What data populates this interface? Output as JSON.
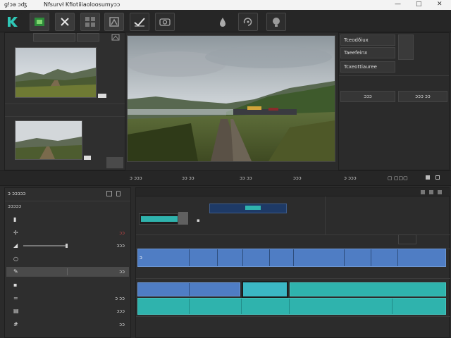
{
  "titlebar": {
    "app_text": "ɡǃɔə ɔʤ",
    "doc_text": "Nfsurvł Kfiotiiiaoloosumyɔɔ",
    "minimize": "—",
    "maximize": "□",
    "close": "✕"
  },
  "toolbar": {
    "icons": [
      "k-logo-icon",
      "film-icon",
      "close-x-icon",
      "grid-icon",
      "layers-icon",
      "checkmark-icon",
      "camera-icon",
      "drop-icon",
      "rotate-icon",
      "globe-icon"
    ]
  },
  "media_panel": {
    "tab_labels": [
      "",
      ""
    ]
  },
  "right_panel": {
    "buttons": [
      "Tceodðiux",
      "Taeefeinx",
      "Tcxeottiauree"
    ],
    "small_buttons": [
      "ɔɔɔ",
      "ɔɔɔ ɔɔ"
    ]
  },
  "transport": {
    "labels": [
      "ɔ ɔɔɔ",
      "ɔɔ ɔɔ",
      "ɔɔ ɔɔ",
      "ɔɔɔ",
      "ɔ ɔɔɔ"
    ]
  },
  "inspector": {
    "title": "ɔ ɔɔɔɔɔ",
    "section": "ɔɔɔɔɔ",
    "rows": [
      {
        "icon": "file-icon",
        "value": ""
      },
      {
        "icon": "star-icon",
        "value": "ɔɔ"
      },
      {
        "icon": "slider-icon",
        "value": "ɔɔɔ",
        "slider": 0.62
      },
      {
        "icon": "circle-icon",
        "value": ""
      },
      {
        "icon": "pencil-icon",
        "value": "ɔɔ"
      },
      {
        "icon": "square-icon",
        "value": ""
      },
      {
        "icon": "equals-icon",
        "value": "ɔ ɔɔ"
      },
      {
        "icon": "doc-icon",
        "value": "ɔɔɔ"
      },
      {
        "icon": "hash-icon",
        "value": "ɔɔ"
      }
    ]
  },
  "timeline": {
    "track_marker": "ɔ"
  },
  "colors": {
    "accent_teal": "#2fb3ad",
    "clip_blue": "#4f7dc4",
    "clip_dark": "#1e3a66",
    "background": "#2b2b2b"
  }
}
